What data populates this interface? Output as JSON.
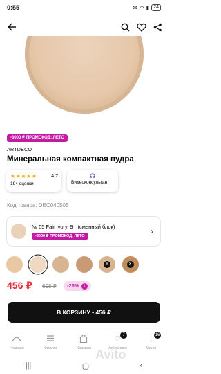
{
  "status_bar": {
    "time": "0:55",
    "icons": [
      "phone-icon",
      "vk-icon",
      "wifi-icon",
      "signal-icon"
    ],
    "battery": "24"
  },
  "top_bar": {
    "back_icon": "arrow-left-icon",
    "search_icon": "search-icon",
    "favorite_icon": "heart-icon",
    "share_icon": "share-icon"
  },
  "product": {
    "promo_badge": "-3000 ₽ ПРОМОКОД: ЛЕТО",
    "brand": "ARTDECO",
    "title": "Минеральная компактная пудра",
    "rating": {
      "stars": 5,
      "value": "4,7",
      "count_label": "194 оценки"
    },
    "consultant_label": "Видеоконсультант",
    "code_label": "Код товара: DEC040505",
    "variant": {
      "name": "№ 05 Fair Ivory, 9 г (сменный блок)",
      "promo": "-3000 ₽ ПРОМОКОД: ЛЕТО"
    },
    "swatches": [
      {
        "color": "#e8c9a3",
        "selected": false,
        "unavailable": false
      },
      {
        "color": "#efd9c3",
        "selected": true,
        "unavailable": false
      },
      {
        "color": "#d9b493",
        "selected": false,
        "unavailable": false
      },
      {
        "color": "#c99b74",
        "selected": false,
        "unavailable": false
      },
      {
        "color": "#d7b390",
        "selected": false,
        "unavailable": true
      },
      {
        "color": "#c08c5b",
        "selected": false,
        "unavailable": true
      }
    ],
    "price": "456 ₽",
    "old_price": "608 ₽",
    "discount": "-25%"
  },
  "cart_button": "В КОРЗИНУ • 456 ₽",
  "tab_bar": [
    {
      "label": "Главная",
      "icon": "home-icon",
      "badge": ""
    },
    {
      "label": "Каталог",
      "icon": "catalog-icon",
      "badge": ""
    },
    {
      "label": "Корзина",
      "icon": "cart-icon",
      "badge": ""
    },
    {
      "label": "Избранное",
      "icon": "heart-icon",
      "badge": "7"
    },
    {
      "label": "Меню",
      "icon": "menu-icon",
      "badge": "16"
    }
  ],
  "watermark": "Avito"
}
